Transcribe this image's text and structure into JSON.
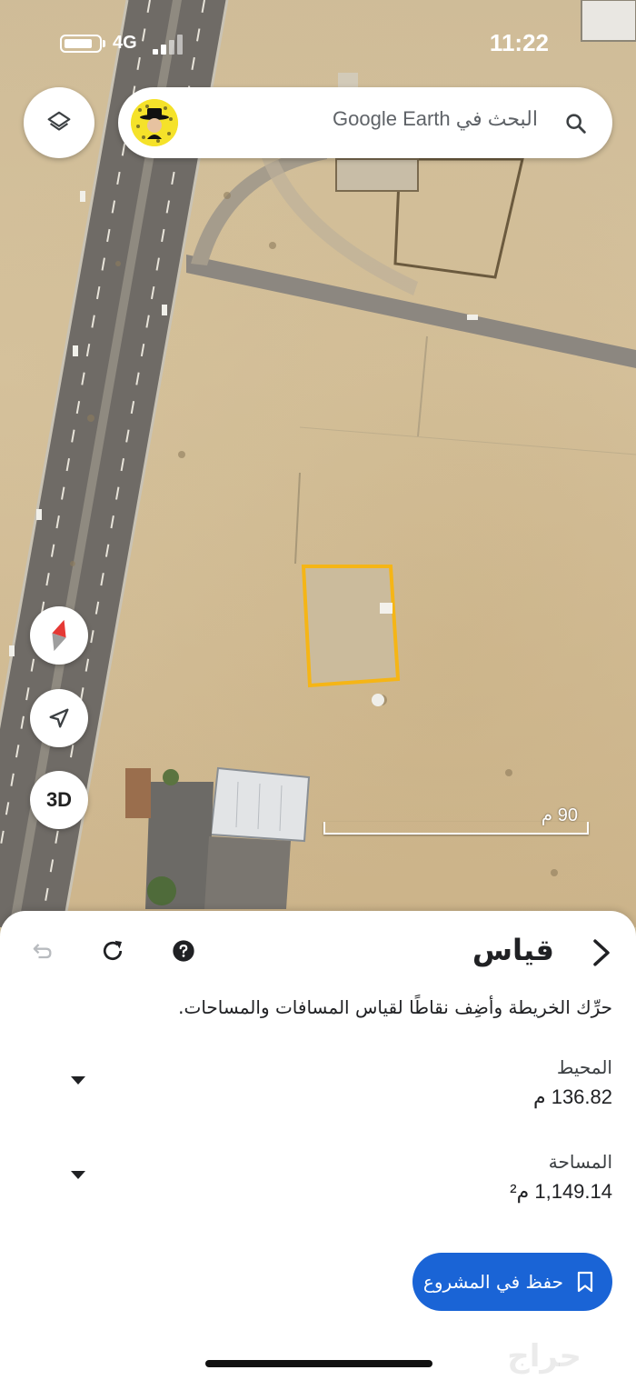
{
  "status_bar": {
    "network": "4G",
    "time": "11:22"
  },
  "search": {
    "placeholder": "البحث في Google Earth"
  },
  "map": {
    "scale_label": "90 م",
    "measure_outline_color": "#f5b516",
    "button_3d": "3D",
    "icons": [
      "layers-icon",
      "compass-icon",
      "my-location-icon",
      "search-icon"
    ]
  },
  "measure_panel": {
    "title": "قياس",
    "instructions": "حرِّك الخريطة وأضِف نقاطًا لقياس المسافات والمساحات.",
    "perimeter": {
      "label": "المحيط",
      "value": "136.82 م"
    },
    "area": {
      "label": "المساحة",
      "value": "1,149.14 م²"
    },
    "save_label": "حفظ في المشروع",
    "icons": [
      "redo-icon",
      "refresh-icon",
      "help-icon",
      "chevron-right-icon",
      "bookmark-icon"
    ]
  },
  "watermark": "حراج",
  "colors": {
    "accent": "#1a64d6",
    "outline": "#f5b516"
  }
}
